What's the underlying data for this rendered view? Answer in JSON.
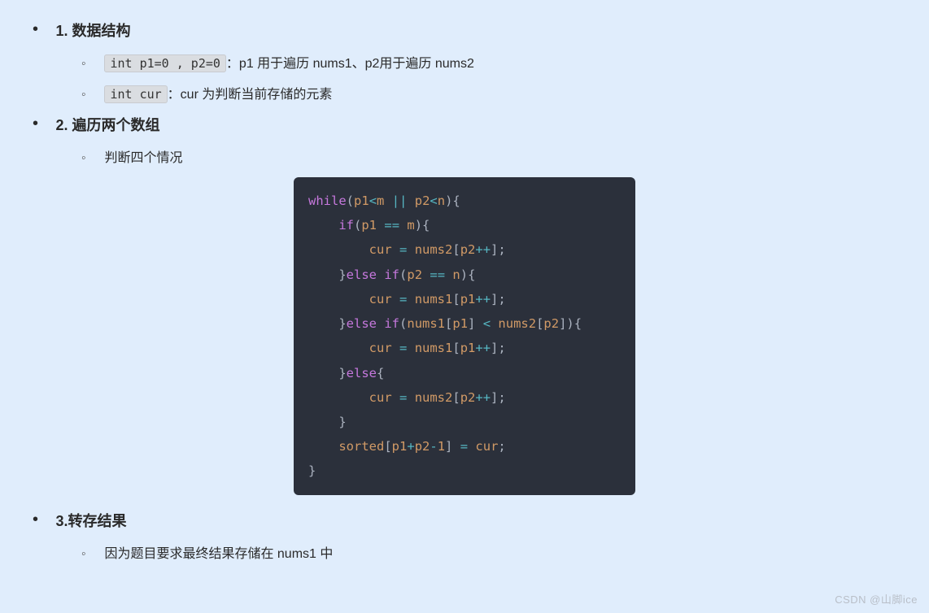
{
  "sections": {
    "s1": {
      "heading": "1. 数据结构",
      "items": [
        {
          "code": "int p1=0 , p2=0",
          "desc": "：p1 用于遍历 nums1、p2用于遍历 nums2"
        },
        {
          "code": "int cur",
          "desc": "：cur 为判断当前存储的元素"
        }
      ]
    },
    "s2": {
      "heading": "2. 遍历两个数组",
      "items": [
        {
          "text": "判断四个情况"
        }
      ],
      "code_tokens": [
        [
          [
            "kw",
            "while"
          ],
          [
            "pun",
            "("
          ],
          [
            "id",
            "p1"
          ],
          [
            "op",
            "<"
          ],
          [
            "id",
            "m"
          ],
          [
            "pun",
            " "
          ],
          [
            "op",
            "||"
          ],
          [
            "pun",
            " "
          ],
          [
            "id",
            "p2"
          ],
          [
            "op",
            "<"
          ],
          [
            "id",
            "n"
          ],
          [
            "pun",
            "){"
          ]
        ],
        [
          [
            "pun",
            "    "
          ],
          [
            "kw",
            "if"
          ],
          [
            "pun",
            "("
          ],
          [
            "id",
            "p1"
          ],
          [
            "pun",
            " "
          ],
          [
            "op",
            "=="
          ],
          [
            "pun",
            " "
          ],
          [
            "id",
            "m"
          ],
          [
            "pun",
            "){"
          ]
        ],
        [
          [
            "pun",
            "        "
          ],
          [
            "id",
            "cur"
          ],
          [
            "pun",
            " "
          ],
          [
            "op",
            "="
          ],
          [
            "pun",
            " "
          ],
          [
            "id",
            "nums2"
          ],
          [
            "pun",
            "["
          ],
          [
            "id",
            "p2"
          ],
          [
            "op",
            "++"
          ],
          [
            "pun",
            "];"
          ]
        ],
        [
          [
            "pun",
            "    }"
          ],
          [
            "kw",
            "else"
          ],
          [
            "pun",
            " "
          ],
          [
            "kw",
            "if"
          ],
          [
            "pun",
            "("
          ],
          [
            "id",
            "p2"
          ],
          [
            "pun",
            " "
          ],
          [
            "op",
            "=="
          ],
          [
            "pun",
            " "
          ],
          [
            "id",
            "n"
          ],
          [
            "pun",
            "){"
          ]
        ],
        [
          [
            "pun",
            "        "
          ],
          [
            "id",
            "cur"
          ],
          [
            "pun",
            " "
          ],
          [
            "op",
            "="
          ],
          [
            "pun",
            " "
          ],
          [
            "id",
            "nums1"
          ],
          [
            "pun",
            "["
          ],
          [
            "id",
            "p1"
          ],
          [
            "op",
            "++"
          ],
          [
            "pun",
            "];"
          ]
        ],
        [
          [
            "pun",
            "    }"
          ],
          [
            "kw",
            "else"
          ],
          [
            "pun",
            " "
          ],
          [
            "kw",
            "if"
          ],
          [
            "pun",
            "("
          ],
          [
            "id",
            "nums1"
          ],
          [
            "pun",
            "["
          ],
          [
            "id",
            "p1"
          ],
          [
            "pun",
            "] "
          ],
          [
            "op",
            "<"
          ],
          [
            "pun",
            " "
          ],
          [
            "id",
            "nums2"
          ],
          [
            "pun",
            "["
          ],
          [
            "id",
            "p2"
          ],
          [
            "pun",
            "]){"
          ]
        ],
        [
          [
            "pun",
            "        "
          ],
          [
            "id",
            "cur"
          ],
          [
            "pun",
            " "
          ],
          [
            "op",
            "="
          ],
          [
            "pun",
            " "
          ],
          [
            "id",
            "nums1"
          ],
          [
            "pun",
            "["
          ],
          [
            "id",
            "p1"
          ],
          [
            "op",
            "++"
          ],
          [
            "pun",
            "];"
          ]
        ],
        [
          [
            "pun",
            "    }"
          ],
          [
            "kw",
            "else"
          ],
          [
            "pun",
            "{"
          ]
        ],
        [
          [
            "pun",
            "        "
          ],
          [
            "id",
            "cur"
          ],
          [
            "pun",
            " "
          ],
          [
            "op",
            "="
          ],
          [
            "pun",
            " "
          ],
          [
            "id",
            "nums2"
          ],
          [
            "pun",
            "["
          ],
          [
            "id",
            "p2"
          ],
          [
            "op",
            "++"
          ],
          [
            "pun",
            "];"
          ]
        ],
        [
          [
            "pun",
            "    }"
          ]
        ],
        [
          [
            "pun",
            "    "
          ],
          [
            "id",
            "sorted"
          ],
          [
            "pun",
            "["
          ],
          [
            "id",
            "p1"
          ],
          [
            "op",
            "+"
          ],
          [
            "id",
            "p2"
          ],
          [
            "op",
            "-"
          ],
          [
            "num",
            "1"
          ],
          [
            "pun",
            "] "
          ],
          [
            "op",
            "="
          ],
          [
            "pun",
            " "
          ],
          [
            "id",
            "cur"
          ],
          [
            "pun",
            ";"
          ]
        ],
        [
          [
            "pun",
            "}"
          ]
        ]
      ]
    },
    "s3": {
      "heading": "3.转存结果",
      "items": [
        {
          "text": "因为题目要求最终结果存储在 nums1 中"
        }
      ]
    }
  },
  "watermark": "CSDN @山脚ice"
}
